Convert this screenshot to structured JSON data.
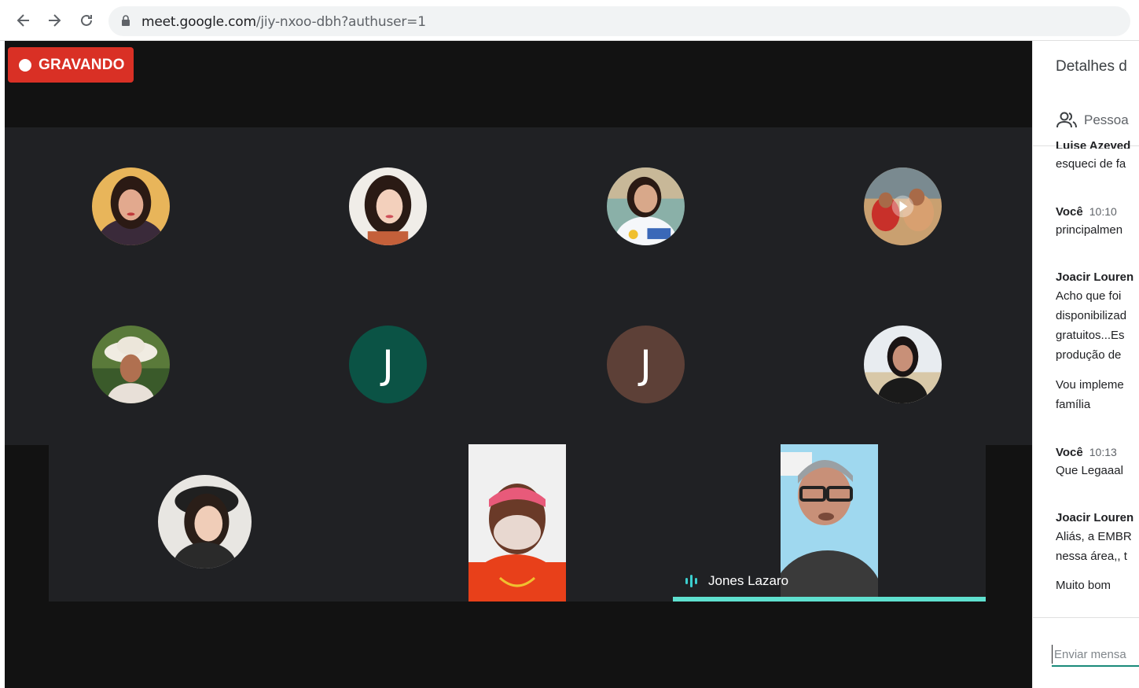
{
  "browser": {
    "url_host": "meet.google.com",
    "url_path": "/jiy-nxoo-dbh?authuser=1"
  },
  "meeting": {
    "recording_label": "GRAVANDO",
    "recording_color": "#d93025",
    "accent_color": "#5fe0cf",
    "participants_letters": [
      "J",
      "J"
    ],
    "active_speaker": "Jones Lazaro"
  },
  "panel": {
    "title": "Detalhes d",
    "people_tab": "Pessoa",
    "messages": [
      {
        "text": "Luise Azeved",
        "kind": "sender-cut"
      },
      {
        "text": "esqueci de fa",
        "kind": "text"
      },
      {
        "sender": "Você",
        "time": "10:10",
        "kind": "sender"
      },
      {
        "text": "principalmen",
        "kind": "text"
      },
      {
        "sender": "Joacir Louren",
        "kind": "sender"
      },
      {
        "text": "Acho que foi",
        "kind": "text"
      },
      {
        "text": "disponibilizad",
        "kind": "text"
      },
      {
        "text": "gratuitos...Es",
        "kind": "text"
      },
      {
        "text": "produção de",
        "kind": "text"
      },
      {
        "text": "Vou impleme",
        "kind": "text"
      },
      {
        "text": "família",
        "kind": "text"
      },
      {
        "sender": "Você",
        "time": "10:13",
        "kind": "sender"
      },
      {
        "text": "Que Legaaal",
        "kind": "text"
      },
      {
        "sender": "Joacir Louren",
        "kind": "sender"
      },
      {
        "text": "Aliás, a EMBR",
        "kind": "text"
      },
      {
        "text": "nessa área,, t",
        "kind": "text"
      },
      {
        "text": "Muito bom",
        "kind": "text"
      }
    ],
    "input_placeholder": "Enviar mensa"
  }
}
